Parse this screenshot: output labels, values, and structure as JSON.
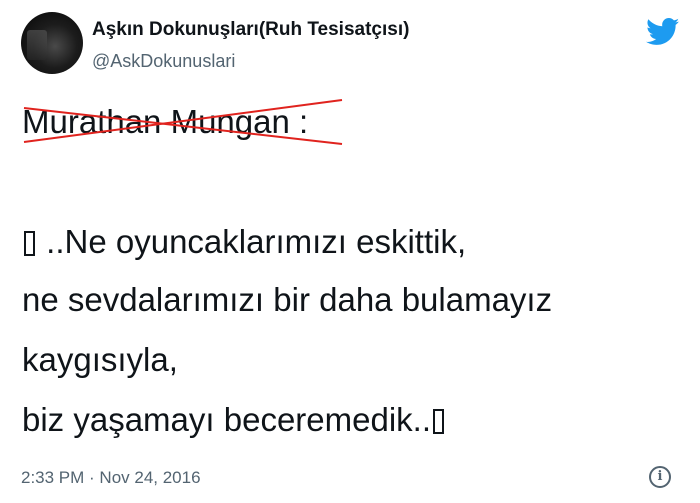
{
  "author": {
    "display_name": "Aşkın Dokunuşları(Ruh Tesisatçısı)",
    "handle": "@AskDokunuslari"
  },
  "tweet": {
    "struck_name": "Murathan Mungan",
    "colon": " :",
    "line2": " ..Ne oyuncaklarımızı eskittik,",
    "line3": "ne sevdalarımızı bir daha bulamayız",
    "line4": "kaygısıyla,",
    "line5": "biz yaşamayı beceremedik.."
  },
  "footer": {
    "timestamp": "2:33 PM · Nov 24, 2016"
  },
  "colors": {
    "twitter_blue": "#1d9bf0",
    "strike_red": "#e0231e",
    "muted_text": "#536471"
  },
  "icons": [
    "avatar",
    "twitter-logo-icon",
    "info-icon"
  ]
}
